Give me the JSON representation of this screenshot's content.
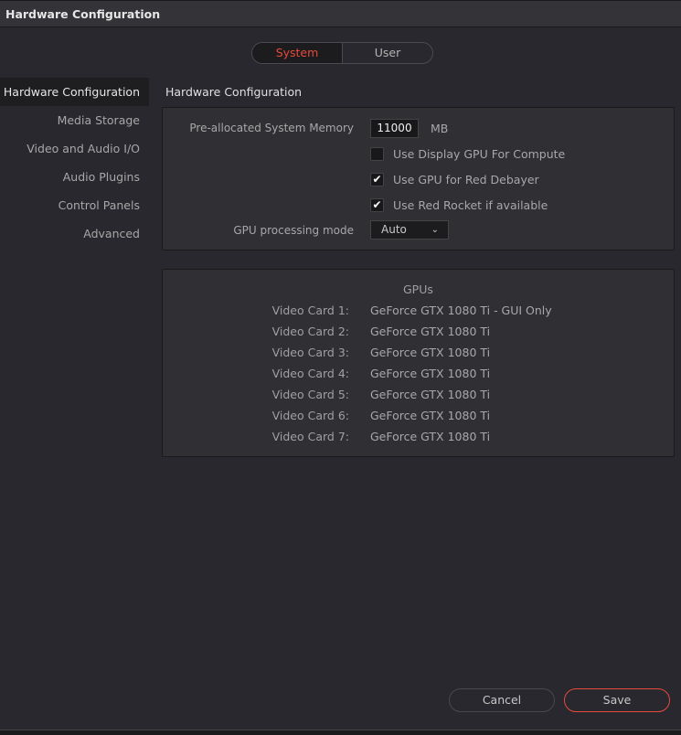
{
  "window": {
    "title": "Hardware Configuration"
  },
  "tabs": [
    {
      "label": "System",
      "active": true
    },
    {
      "label": "User",
      "active": false
    }
  ],
  "sidebar": {
    "items": [
      {
        "label": "Hardware Configuration",
        "active": true
      },
      {
        "label": "Media Storage"
      },
      {
        "label": "Video and Audio I/O"
      },
      {
        "label": "Audio Plugins"
      },
      {
        "label": "Control Panels"
      },
      {
        "label": "Advanced"
      }
    ]
  },
  "section": {
    "title": "Hardware Configuration"
  },
  "settings": {
    "memory_label": "Pre-allocated System Memory",
    "memory_value": "11000",
    "memory_unit": "MB",
    "checkboxes": [
      {
        "label": "Use Display GPU For Compute",
        "checked": false
      },
      {
        "label": "Use GPU for Red Debayer",
        "checked": true
      },
      {
        "label": "Use Red Rocket if available",
        "checked": true
      }
    ],
    "gpu_mode_label": "GPU processing mode",
    "gpu_mode_value": "Auto"
  },
  "gpus": {
    "title": "GPUs",
    "cards": [
      {
        "label": "Video Card 1:",
        "name": "GeForce GTX 1080 Ti - GUI Only"
      },
      {
        "label": "Video Card 2:",
        "name": "GeForce GTX 1080 Ti"
      },
      {
        "label": "Video Card 3:",
        "name": "GeForce GTX 1080 Ti"
      },
      {
        "label": "Video Card 4:",
        "name": "GeForce GTX 1080 Ti"
      },
      {
        "label": "Video Card 5:",
        "name": "GeForce GTX 1080 Ti"
      },
      {
        "label": "Video Card 6:",
        "name": "GeForce GTX 1080 Ti"
      },
      {
        "label": "Video Card 7:",
        "name": "GeForce GTX 1080 Ti"
      }
    ]
  },
  "buttons": {
    "cancel": "Cancel",
    "save": "Save"
  },
  "colors": {
    "accent": "#e64b3c",
    "background": "#28282e"
  }
}
